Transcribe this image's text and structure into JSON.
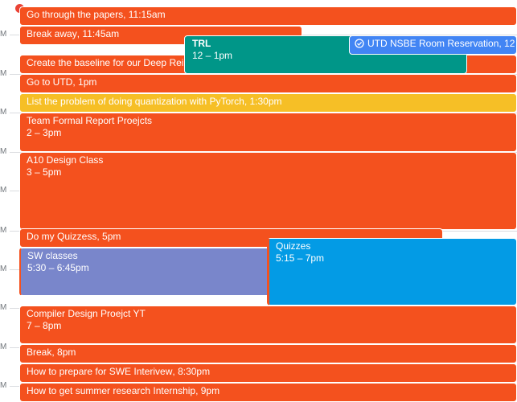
{
  "gutter_labels": [
    "M",
    "M",
    "M",
    "M",
    "M",
    "M",
    "M",
    "M",
    "M",
    "M",
    "M"
  ],
  "colors": {
    "tomato": "#f4511e",
    "peacock": "#039be5",
    "basil": "#009688",
    "banana": "#f6bf26",
    "lavender": "#7986cb",
    "blueberry": "#4285f4",
    "now": "#ea4335"
  },
  "events": {
    "papers": {
      "title": "Go through the papers",
      "time": ", 11:15am"
    },
    "break_away": {
      "title": "Break away",
      "time": ", 11:45am"
    },
    "trl": {
      "title": "TRL",
      "time": "12 – 1pm"
    },
    "utd_nsbe": {
      "title": "UTD NSBE Room Reservation, 12"
    },
    "baseline": {
      "title": "Create the baseline for our Deep Rei"
    },
    "go_utd": {
      "title": "Go to UTD",
      "time": ", 1pm"
    },
    "quantization": {
      "title": "List the problem of doing quantization with PyTorch",
      "time": ", 1:30pm"
    },
    "team_formal": {
      "title": "Team Formal Report Proejcts",
      "time": "2 – 3pm"
    },
    "a10": {
      "title": "A10 Design Class",
      "time": "3 – 5pm"
    },
    "quizzess": {
      "title": "Do my Quizzess",
      "time": ", 5pm"
    },
    "sw_classes": {
      "title": "SW classes",
      "time": "5:30 – 6:45pm"
    },
    "quizzes": {
      "title": "Quizzes",
      "time": "5:15 – 7pm"
    },
    "compiler": {
      "title": "Compiler Design Proejct YT",
      "time": "7 – 8pm"
    },
    "break": {
      "title": "Break",
      "time": ", 8pm"
    },
    "swe": {
      "title": "How to prepare for SWE Interivew",
      "time": ", 8:30pm"
    },
    "summer": {
      "title": "How to get summer research Internship",
      "time": ", 9pm"
    }
  }
}
